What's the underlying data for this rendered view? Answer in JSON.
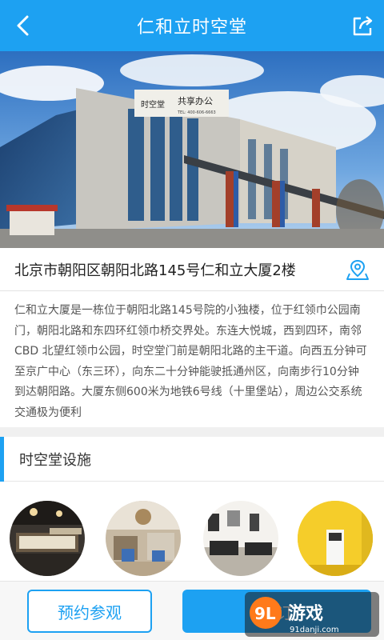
{
  "header": {
    "title": "仁和立时空堂",
    "back_icon": "back-arrow-icon",
    "share_icon": "share-icon",
    "color": "#1da1f2"
  },
  "hero": {
    "sign_left": "时空堂",
    "sign_right": "共享办公",
    "sign_tel": "TEL: 400-606-6663"
  },
  "address": {
    "text": "北京市朝阳区朝阳北路145号仁和立大厦2楼",
    "icon": "map-pin-icon"
  },
  "description": "仁和立大厦是一栋位于朝阳北路145号院的小独楼，位于红领巾公园南门，朝阳北路和东四环红领巾桥交界处。东连大悦城，西到四环，南邻CBD 北望红领巾公园，时空堂门前是朝阳北路的主干道。向西五分钟可至京广中心（东三环），向东二十分钟能驶抵通州区，向南步行10分钟到达朝阳路。大厦东侧600米为地铁6号线（十里堡站），周边公交系统交通极为便利",
  "facilities": {
    "title": "时空堂设施",
    "items": [
      "lounge-photo",
      "dining-hall-photo",
      "game-room-photo",
      "reception-photo"
    ]
  },
  "actions": {
    "visit_label": "预约参观",
    "book_label": "预订"
  },
  "watermark": {
    "logo": "9L",
    "name": "游戏",
    "url": "91danji.com"
  }
}
